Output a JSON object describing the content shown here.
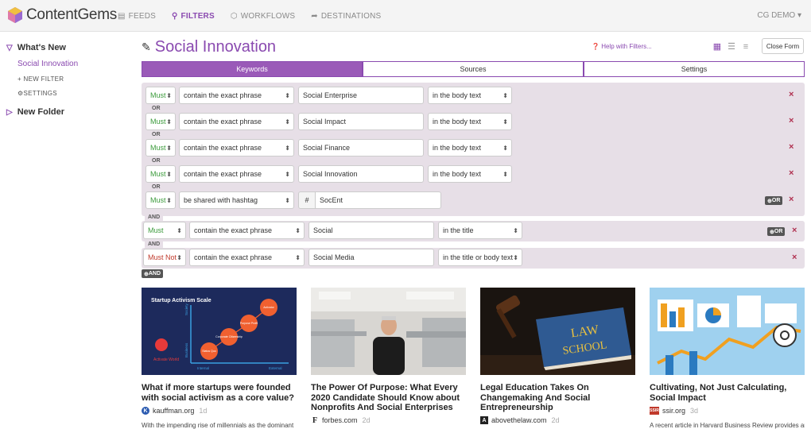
{
  "app": {
    "name": "ContentGems",
    "user": "CG DEMO"
  },
  "nav": [
    {
      "label": "FEEDS",
      "icon": "rss-icon"
    },
    {
      "label": "FILTERS",
      "icon": "search-icon",
      "active": true
    },
    {
      "label": "WORKFLOWS",
      "icon": "workflow-icon"
    },
    {
      "label": "DESTINATIONS",
      "icon": "share-icon"
    }
  ],
  "sidebar": {
    "folder1": "What's New",
    "active_filter": "Social Innovation",
    "new_filter": "NEW FILTER",
    "settings": "SETTINGS",
    "folder2": "New Folder"
  },
  "page": {
    "title": "Social Innovation",
    "help": "Help with Filters...",
    "close_form": "Close Form"
  },
  "tabs": [
    "Keywords",
    "Sources",
    "Settings"
  ],
  "rules_group": [
    {
      "qualifier": "Must",
      "condition": "contain the exact phrase",
      "value": "Social Enterprise",
      "location": "in the body text"
    },
    {
      "qualifier": "Must",
      "condition": "contain the exact phrase",
      "value": "Social Impact",
      "location": "in the body text"
    },
    {
      "qualifier": "Must",
      "condition": "contain the exact phrase",
      "value": "Social Finance",
      "location": "in the body text"
    },
    {
      "qualifier": "Must",
      "condition": "contain the exact phrase",
      "value": "Social Innovation",
      "location": "in the body text"
    },
    {
      "qualifier": "Must",
      "condition": "be shared with hashtag",
      "hash": "#",
      "value": "SocEnt"
    }
  ],
  "rule_title": {
    "qualifier": "Must",
    "condition": "contain the exact phrase",
    "value": "Social",
    "location": "in the title"
  },
  "rule_not": {
    "qualifier": "Must Not",
    "condition": "contain the exact phrase",
    "value": "Social Media",
    "location": "in the title or body text"
  },
  "labels": {
    "or": "OR",
    "and": "AND",
    "or_btn": "OR",
    "and_btn": "AND",
    "remove": "×"
  },
  "cards": [
    {
      "title": "What if more startups were founded with social activism as a core value?",
      "source": "kauffman.org",
      "age": "1d",
      "excerpt": "With the impending rise of millennials as the dominant",
      "thumb": {
        "heading": "Startup Activism Scale",
        "y_axis": "Society",
        "y_axis2": "Business",
        "x_axis": "Internal",
        "x_axis2": "External",
        "stages": [
          "Status Quo",
          "Corporate Citizenship",
          "Purpose Profit",
          "Activator"
        ],
        "brand": "Activate World"
      }
    },
    {
      "title": "The Power Of Purpose: What Every 2020 Candidate Should Know about Nonprofits And Social Enterprises",
      "source": "forbes.com",
      "age": "2d",
      "excerpt": ""
    },
    {
      "title": "Legal Education Takes On Changemaking And Social Entrepreneurship",
      "source": "abovethelaw.com",
      "age": "2d",
      "excerpt": "",
      "thumb": {
        "book_line1": "LAW",
        "book_line2": "SCHOOL"
      }
    },
    {
      "title": "Cultivating, Not Just Calculating, Social Impact",
      "source": "ssir.org",
      "age": "3d",
      "excerpt": "A recent article in Harvard Business Review provides an"
    }
  ]
}
